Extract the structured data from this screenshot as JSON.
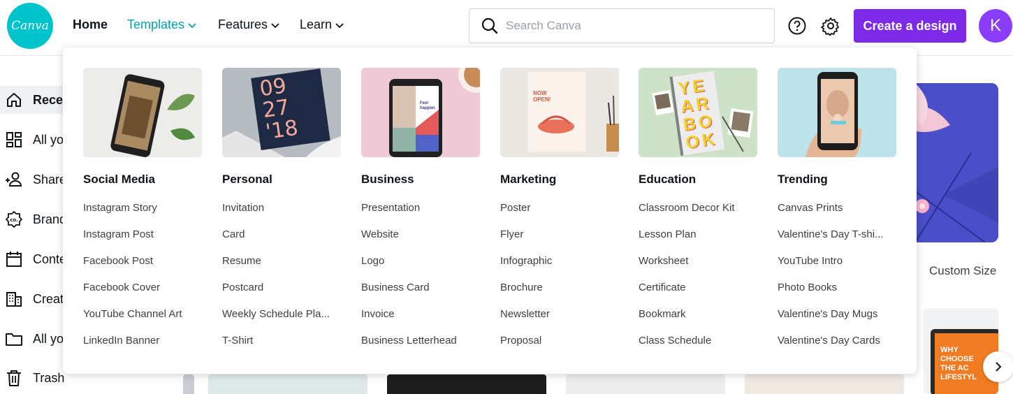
{
  "logo": {
    "text": "Canva"
  },
  "nav": {
    "home": "Home",
    "templates": "Templates",
    "features": "Features",
    "learn": "Learn"
  },
  "search": {
    "placeholder": "Search Canva"
  },
  "header": {
    "create_label": "Create a design",
    "avatar_initial": "K"
  },
  "sidebar": {
    "items": [
      {
        "label": "Recen",
        "icon": "home-icon"
      },
      {
        "label": "All yo",
        "icon": "grid-icon"
      },
      {
        "label": "Share",
        "icon": "people-icon"
      },
      {
        "label": "Brand",
        "icon": "brand-kit-icon"
      },
      {
        "label": "Conte",
        "icon": "calendar-icon"
      },
      {
        "label": "Creat",
        "icon": "building-icon"
      },
      {
        "label": "All yo",
        "icon": "folder-icon"
      },
      {
        "label": "Trash",
        "icon": "trash-icon"
      }
    ]
  },
  "background": {
    "custom_size": "Custom Size",
    "card_text": "WHY\nCHOOSE\nTHE AC\nLIFESTYL"
  },
  "dropdown": {
    "columns": [
      {
        "title": "Social Media",
        "items": [
          "Instagram Story",
          "Instagram Post",
          "Facebook Post",
          "Facebook Cover",
          "YouTube Channel Art",
          "LinkedIn Banner"
        ]
      },
      {
        "title": "Personal",
        "items": [
          "Invitation",
          "Card",
          "Resume",
          "Postcard",
          "Weekly Schedule Pla...",
          "T-Shirt"
        ]
      },
      {
        "title": "Business",
        "items": [
          "Presentation",
          "Website",
          "Logo",
          "Business Card",
          "Invoice",
          "Business Letterhead"
        ]
      },
      {
        "title": "Marketing",
        "items": [
          "Poster",
          "Flyer",
          "Infographic",
          "Brochure",
          "Newsletter",
          "Proposal"
        ]
      },
      {
        "title": "Education",
        "items": [
          "Classroom Decor Kit",
          "Lesson Plan",
          "Worksheet",
          "Certificate",
          "Bookmark",
          "Class Schedule"
        ]
      },
      {
        "title": "Trending",
        "items": [
          "Canvas Prints",
          "Valentine's Day T-shi...",
          "YouTube Intro",
          "Photo Books",
          "Valentine's Day Mugs",
          "Valentine's Day Cards"
        ]
      }
    ],
    "thumb_text": {
      "personal": "09\n27\n'18",
      "business": "Feel\nhappier.",
      "marketing": "NOW\nOPEN!",
      "education": "YE\nAR\nBO\nOK"
    }
  },
  "colors": {
    "brand_teal": "#00c4cc",
    "primary_purple": "#7d2ae8",
    "active_nav": "#00a2b0"
  }
}
